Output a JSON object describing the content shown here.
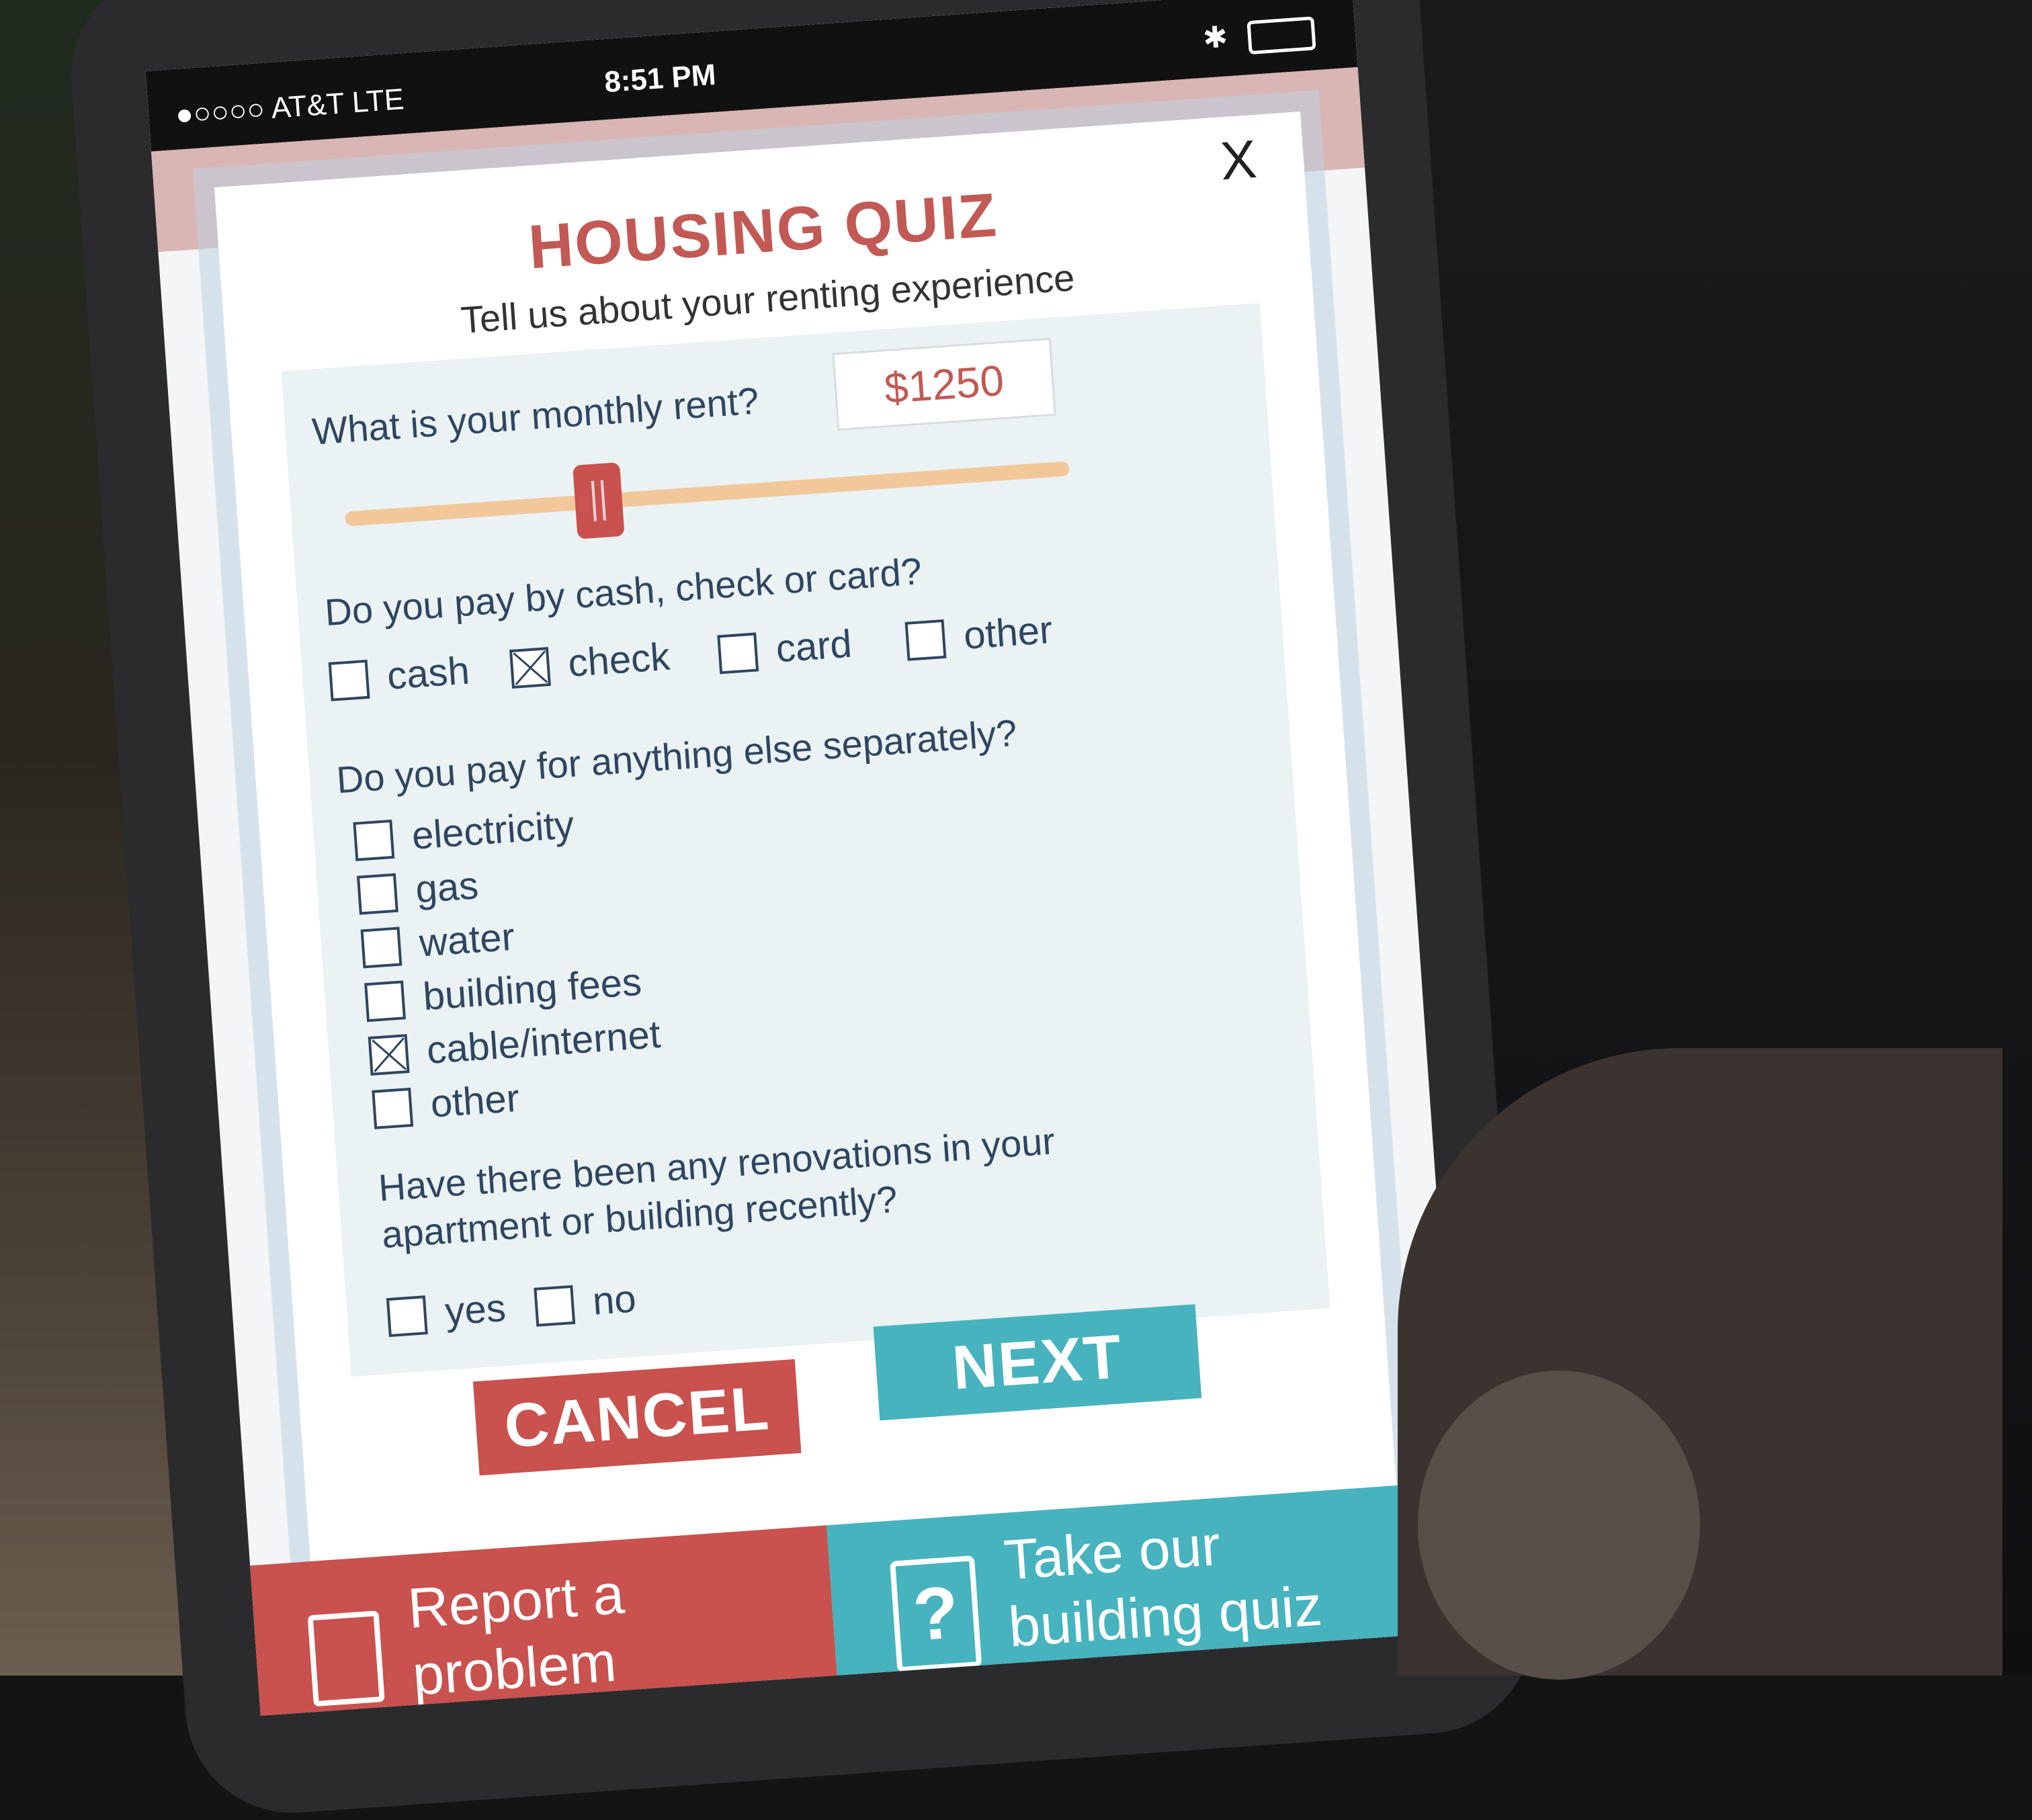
{
  "status_bar": {
    "carrier": "●○○○○ AT&T  LTE",
    "time": "8:51 PM"
  },
  "modal": {
    "close_label": "X",
    "title": "HOUSING QUIZ",
    "subtitle": "Tell us about your renting experience",
    "rent": {
      "question": "What is your monthly rent?",
      "value": "$1250",
      "slider_fraction": 0.35
    },
    "payment": {
      "question": "Do you pay by cash, check or card?",
      "options": [
        {
          "label": "cash",
          "checked": false
        },
        {
          "label": "check",
          "checked": true
        },
        {
          "label": "card",
          "checked": false
        },
        {
          "label": "other",
          "checked": false
        }
      ]
    },
    "extras": {
      "question": "Do you pay for anything else separately?",
      "options": [
        {
          "label": "electricity",
          "checked": false
        },
        {
          "label": "gas",
          "checked": false
        },
        {
          "label": "water",
          "checked": false
        },
        {
          "label": "building fees",
          "checked": false
        },
        {
          "label": "cable/internet",
          "checked": true
        },
        {
          "label": "other",
          "checked": false
        }
      ]
    },
    "renovations": {
      "question_line1": "Have there been any renovations in your",
      "question_line2": "apartment or building recently?",
      "options": [
        {
          "label": "yes",
          "checked": false
        },
        {
          "label": "no",
          "checked": false
        }
      ]
    },
    "cancel_label": "CANCEL",
    "next_label": "NEXT"
  },
  "bottom_nav": {
    "report_line1": "Report a",
    "report_line2": "problem",
    "quiz_line1": "Take our",
    "quiz_line2": "building quiz",
    "quiz_icon": "?"
  },
  "colors": {
    "accent_red": "#c9514e",
    "accent_teal": "#47b3bf",
    "slider_track": "#f2c79a"
  }
}
